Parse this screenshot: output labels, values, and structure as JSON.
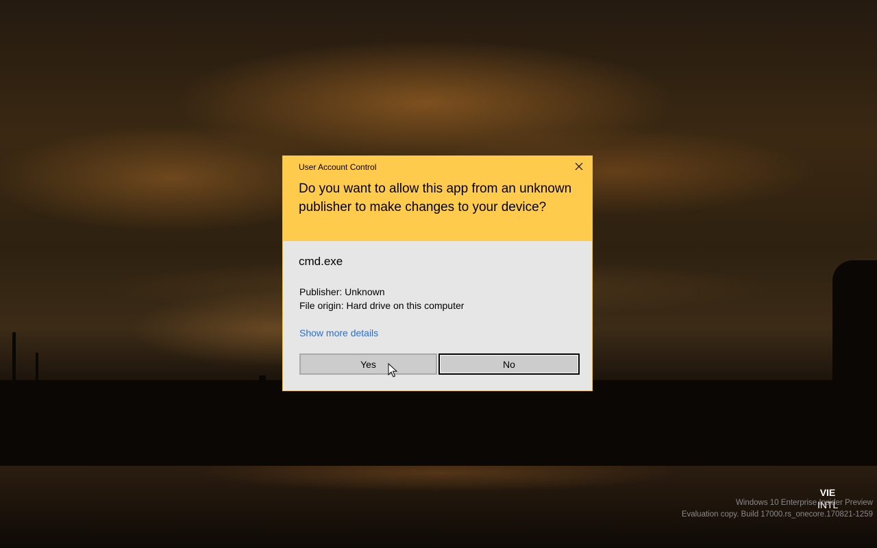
{
  "dialog": {
    "title": "User Account Control",
    "question": "Do you want to allow this app from an unknown publisher to make changes to your device?",
    "app_name": "cmd.exe",
    "publisher": "Publisher: Unknown",
    "file_origin": "File origin: Hard drive on this computer",
    "more_details": "Show more details",
    "yes_label": "Yes",
    "no_label": "No",
    "close_icon": "close-icon"
  },
  "input_indicator": {
    "language": "VIE",
    "layout": "INTL"
  },
  "watermark": {
    "line1": "Windows 10 Enterprise Insider Preview",
    "line2": "Evaluation copy. Build 17000.rs_onecore.170821-1259"
  },
  "colors": {
    "header": "#ffcb4c",
    "body": "#e6e6e6",
    "link": "#2a6fd1",
    "button": "#cccccc"
  }
}
